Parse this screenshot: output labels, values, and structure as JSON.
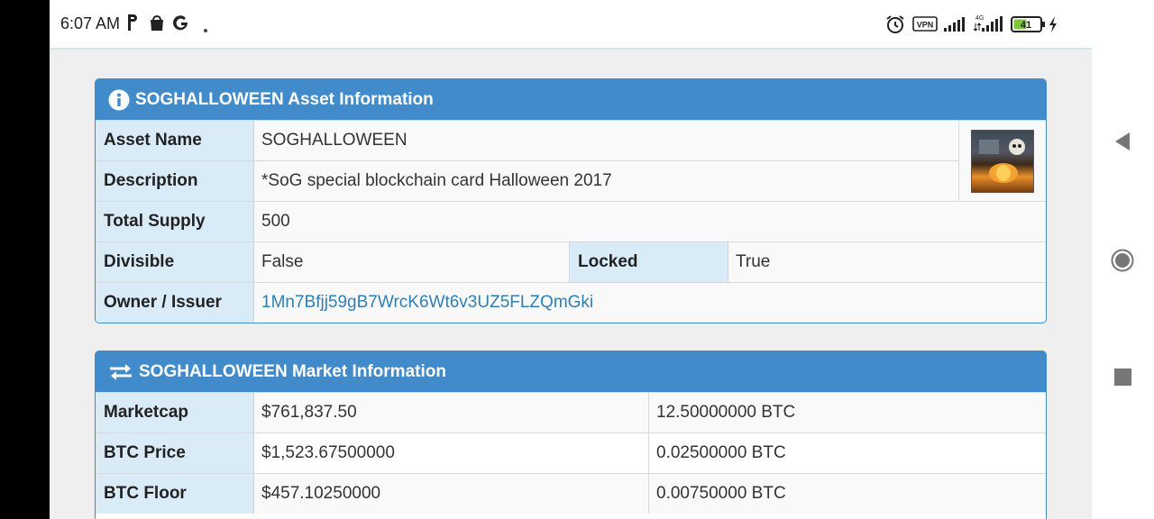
{
  "status_bar": {
    "time": "6:07 AM",
    "vpn_label": "VPN",
    "network_label": "4G",
    "battery_level": "41"
  },
  "asset_panel": {
    "title": "SOGHALLOWEEN Asset Information",
    "rows": {
      "asset_name": {
        "label": "Asset Name",
        "value": "SOGHALLOWEEN"
      },
      "description": {
        "label": "Description",
        "value": "*SoG special blockchain card Halloween 2017"
      },
      "total_supply": {
        "label": "Total Supply",
        "value": "500"
      },
      "divisible": {
        "label": "Divisible",
        "value": "False"
      },
      "locked": {
        "label": "Locked",
        "value": "True"
      },
      "owner": {
        "label": "Owner / Issuer",
        "value": "1Mn7Bfjj59gB7WrcK6Wt6v3UZ5FLZQmGki"
      }
    }
  },
  "market_panel": {
    "title": "SOGHALLOWEEN Market Information",
    "rows": [
      {
        "label": "Marketcap",
        "usd": "$761,837.50",
        "btc": "12.50000000 BTC"
      },
      {
        "label": "BTC Price",
        "usd": "$1,523.67500000",
        "btc": "0.02500000 BTC"
      },
      {
        "label": "BTC Floor",
        "usd": "$457.10250000",
        "btc": "0.00750000 BTC"
      }
    ]
  },
  "colors": {
    "panel_header": "#428bca",
    "label_bg": "#d9ebf7",
    "link": "#2f7fb6"
  }
}
